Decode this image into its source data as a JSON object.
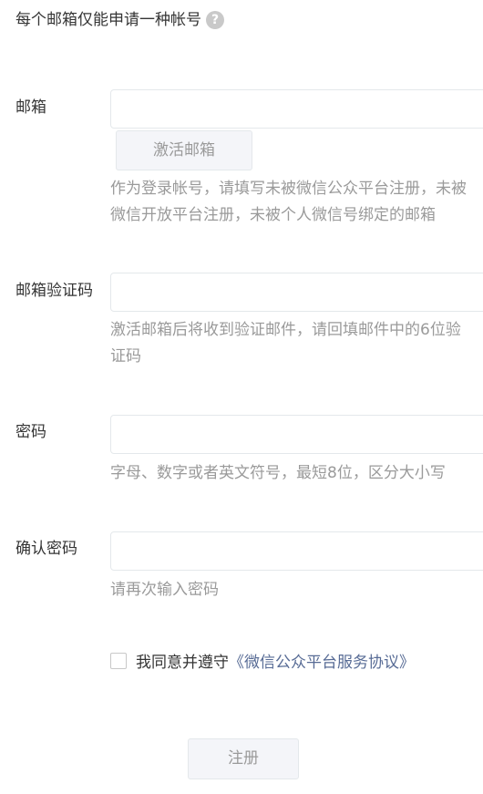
{
  "notice": {
    "text": "每个邮箱仅能申请一种帐号",
    "help_icon": "?"
  },
  "fields": {
    "email": {
      "label": "邮箱",
      "value": "",
      "activate_button": "激活邮箱",
      "tip": "作为登录帐号，请填写未被微信公众平台注册，未被微信开放平台注册，未被个人微信号绑定的邮箱"
    },
    "email_code": {
      "label": "邮箱验证码",
      "value": "",
      "tip": "激活邮箱后将收到验证邮件，请回填邮件中的6位验证码"
    },
    "password": {
      "label": "密码",
      "value": "",
      "tip": "字母、数字或者英文符号，最短8位，区分大小写"
    },
    "confirm_password": {
      "label": "确认密码",
      "value": "",
      "tip": "请再次输入密码"
    }
  },
  "agreement": {
    "checked": false,
    "text": "我同意并遵守",
    "link": "《微信公众平台服务协议》"
  },
  "register_button": "注册",
  "colors": {
    "text": "#353535",
    "tip": "#9a9a9a",
    "link": "#576b95",
    "border": "#e4e8eb",
    "button_bg": "#f4f5f9"
  }
}
